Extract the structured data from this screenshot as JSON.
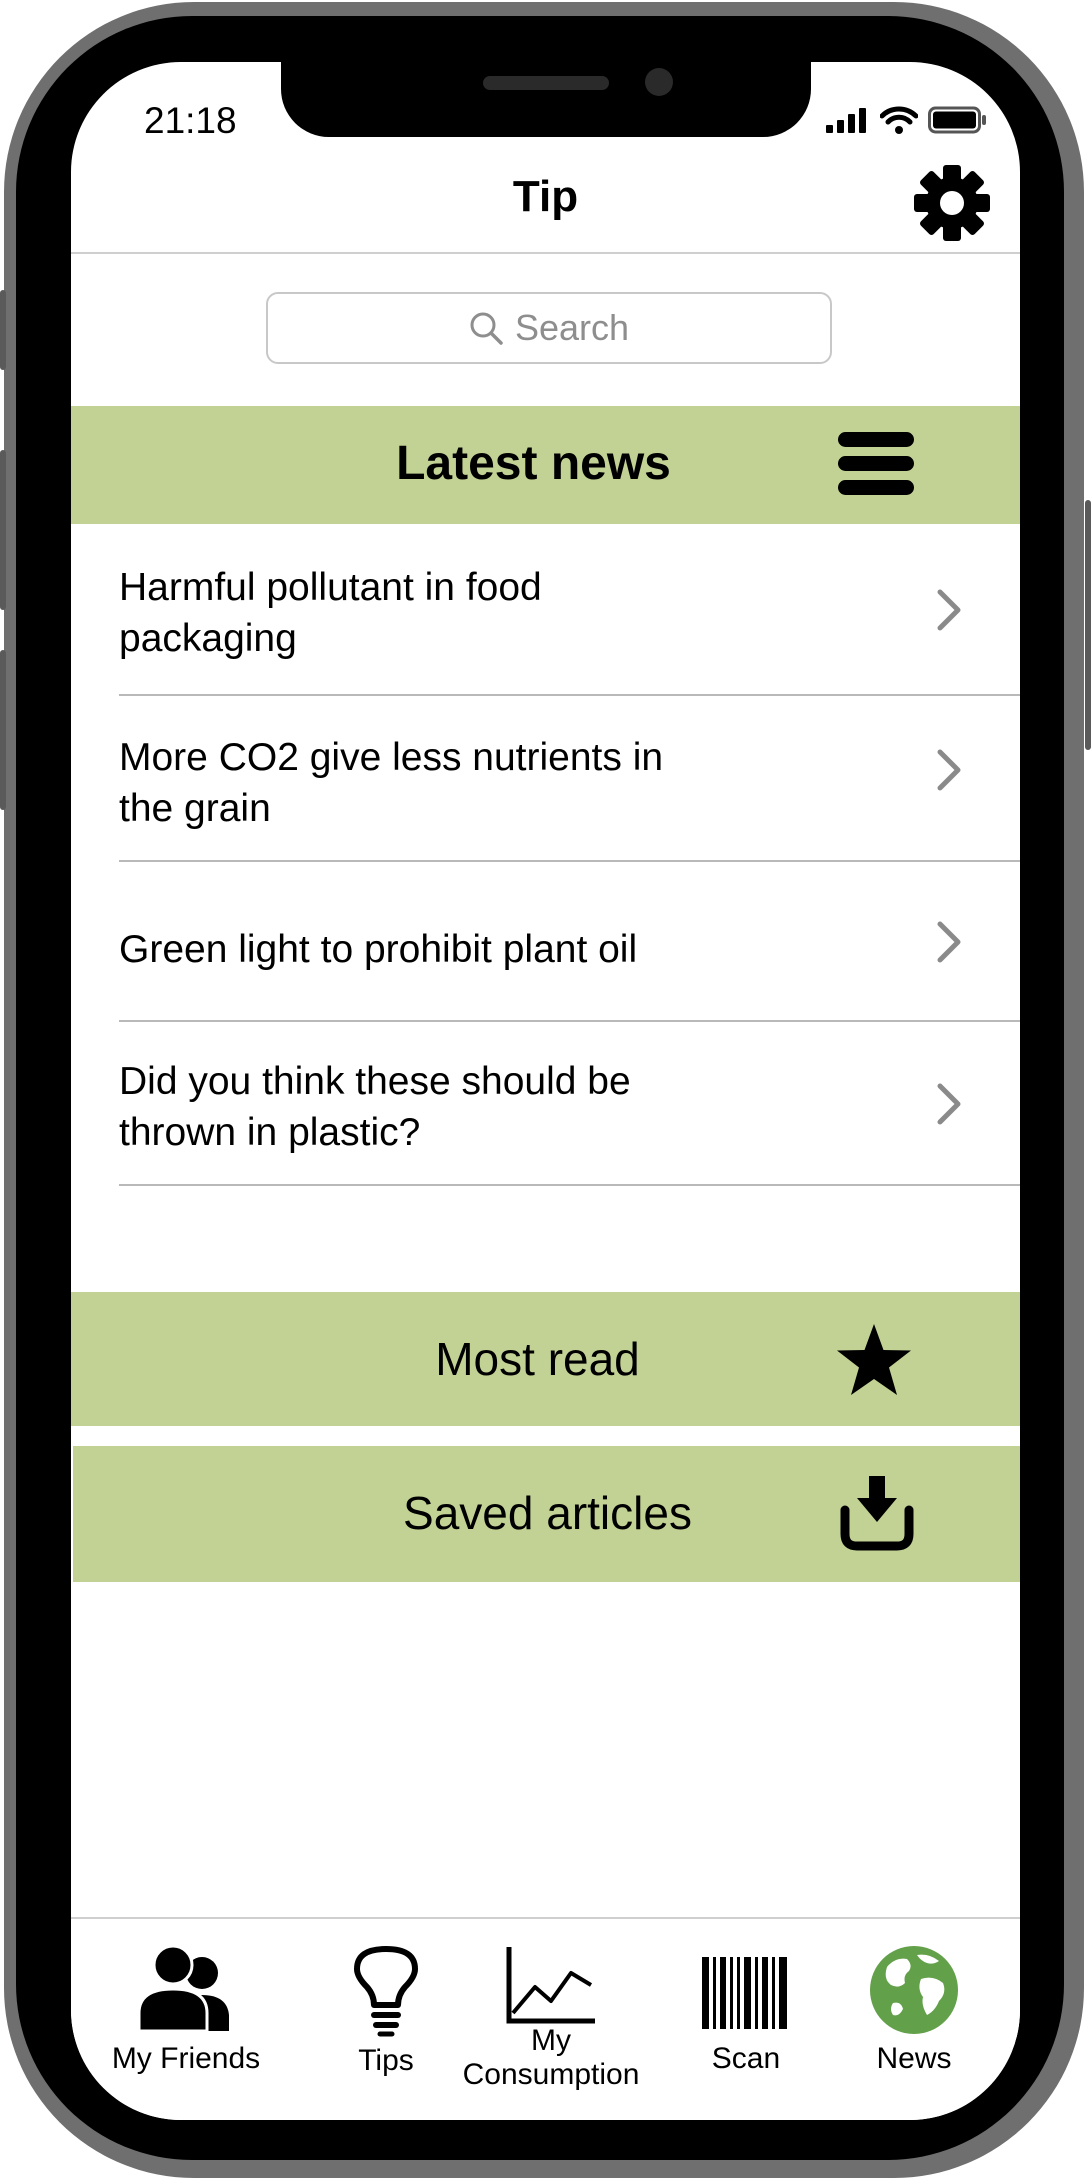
{
  "status_bar": {
    "time": "21:18"
  },
  "header": {
    "title": "Tip",
    "settings_icon": "gear-icon"
  },
  "search": {
    "placeholder": "Search"
  },
  "latest_news": {
    "title": "Latest news",
    "menu_icon": "menu-icon",
    "items": [
      {
        "line1": "Harmful pollutant in food",
        "line2": "packaging"
      },
      {
        "line1": "More CO2 give less nutrients in",
        "line2": "the grain"
      },
      {
        "line1": "Green light to prohibit plant oil",
        "line2": ""
      },
      {
        "line1": "Did you think these should be",
        "line2": "thrown in plastic?"
      }
    ]
  },
  "most_read": {
    "label": "Most read",
    "icon": "star-icon"
  },
  "saved_articles": {
    "label": "Saved articles",
    "icon": "download-icon"
  },
  "tabbar": {
    "tabs": [
      {
        "label": "My Friends",
        "icon": "users-icon"
      },
      {
        "label": "Tips",
        "icon": "lightbulb-icon"
      },
      {
        "label_line1": "My",
        "label_line2": "Consumption",
        "icon": "chart-icon"
      },
      {
        "label": "Scan",
        "icon": "barcode-icon"
      },
      {
        "label": "News",
        "icon": "globe-icon"
      }
    ]
  },
  "colors": {
    "section_bg": "#c2d294",
    "globe_green": "#63a04a",
    "globe_land": "#ffffff"
  }
}
